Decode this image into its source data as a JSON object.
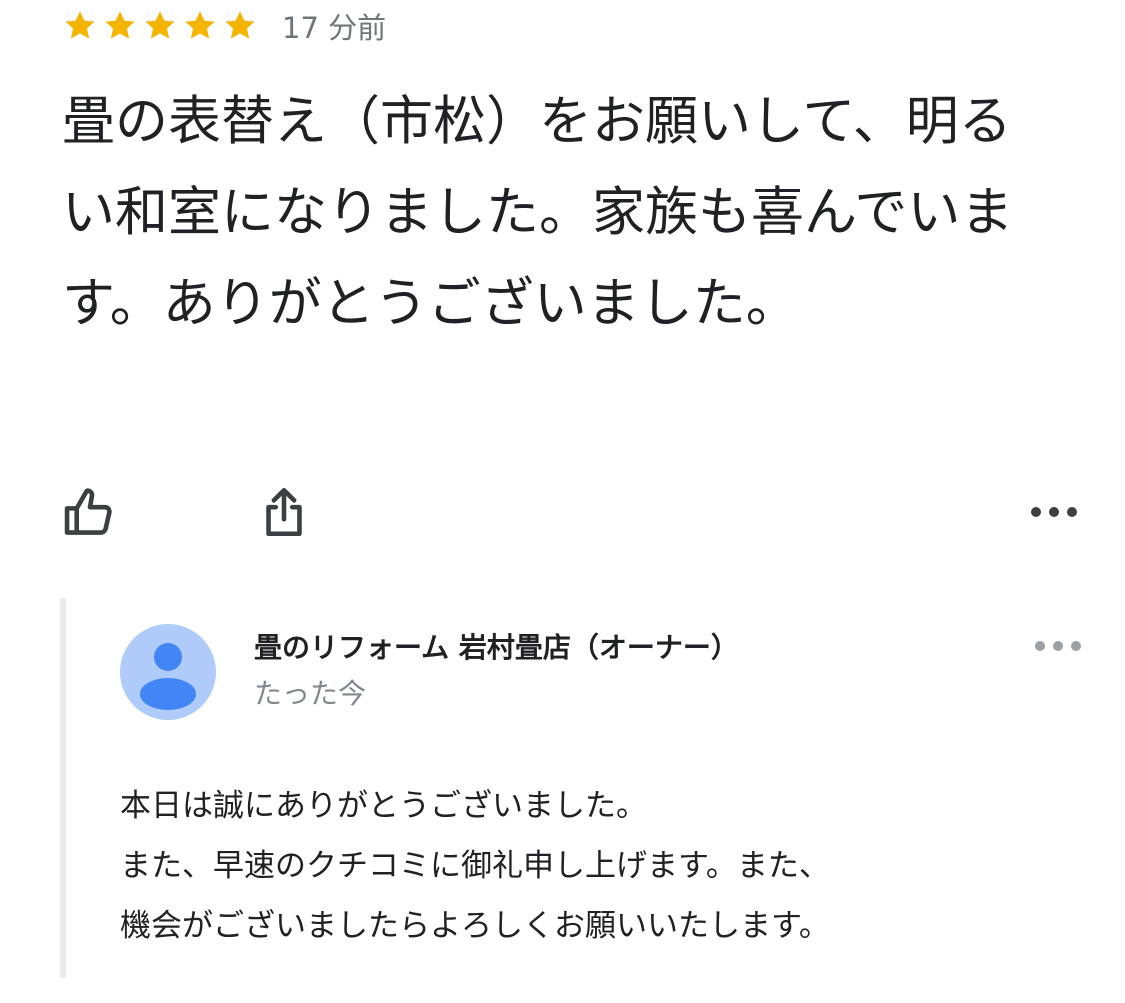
{
  "review": {
    "rating": 5,
    "rating_max": 5,
    "star_color": "#f4b400",
    "time_ago": "17 分前",
    "text": "畳の表替え（市松）をお願いして、明るい和室になりました。家族も喜んでいます。ありがとうございました。"
  },
  "actions": {
    "like_icon": "thumbs-up-icon",
    "share_icon": "share-icon",
    "more_icon": "more-horizontal-icon"
  },
  "owner_response": {
    "name": "畳のリフォーム 岩村畳店（オーナー）",
    "time": "たった今",
    "avatar_icon": "person-icon",
    "avatar_color": "#aecbfa",
    "avatar_figure_color": "#4285f4",
    "lines": [
      "本日は誠にありがとうございました。",
      "また、早速のクチコミに御礼申し上げます。また、",
      "機会がございましたらよろしくお願いいたします。"
    ]
  }
}
